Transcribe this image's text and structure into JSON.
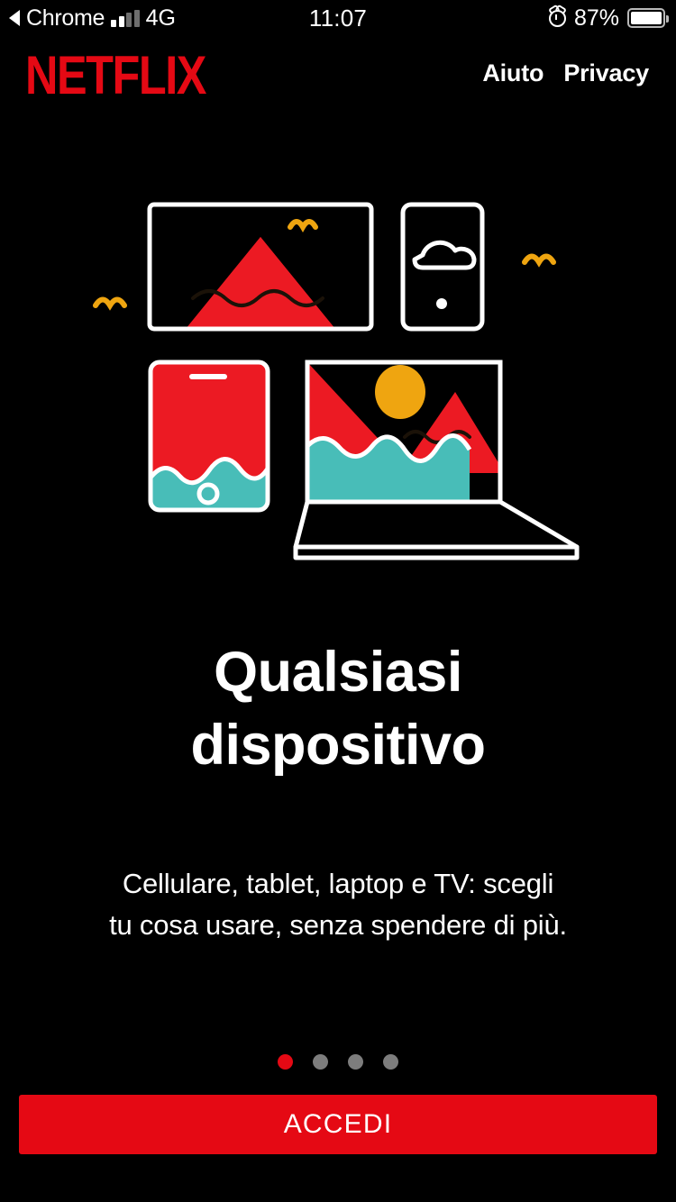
{
  "status_bar": {
    "back_label": "Chrome",
    "back_icon": "back-triangle-icon",
    "signal_icon": "signal-bars-icon",
    "network": "4G",
    "time": "11:07",
    "alarm_icon": "alarm-clock-icon",
    "battery_percent": "87%",
    "battery_icon": "battery-icon"
  },
  "header": {
    "logo": "NETFLIX",
    "nav": [
      {
        "label": "Aiuto"
      },
      {
        "label": "Privacy"
      }
    ]
  },
  "illustration": {
    "name": "any-device-illustration",
    "devices": [
      "tv",
      "tablet",
      "phone",
      "laptop"
    ],
    "birds": 3,
    "colors": {
      "red": "#EC1A23",
      "teal": "#48BDB8",
      "gold": "#EFA510",
      "outline": "#FFFFFF",
      "background": "#000000"
    }
  },
  "main": {
    "title_line1": "Qualsiasi",
    "title_line2": "dispositivo",
    "subtitle_line1": "Cellulare, tablet, laptop e TV: scegli",
    "subtitle_line2": "tu cosa usare, senza spendere di più."
  },
  "pagination": {
    "total": 4,
    "active_index": 0,
    "active_color": "#E50914",
    "inactive_color": "#7D7D7D"
  },
  "cta": {
    "label": "ACCEDI",
    "color": "#E50914"
  }
}
